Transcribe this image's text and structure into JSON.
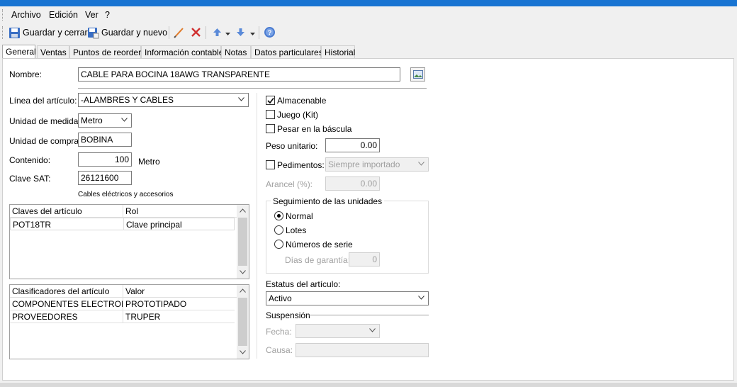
{
  "menu": {
    "archivo": "Archivo",
    "edicion": "Edición",
    "ver": "Ver",
    "help": "?"
  },
  "toolbar": {
    "save_close": "Guardar y cerrar",
    "save_new": "Guardar y nuevo"
  },
  "tabs": [
    "General",
    "Ventas",
    "Puntos de reorden",
    "Información contable",
    "Notas",
    "Datos particulares",
    "Historial"
  ],
  "form": {
    "nombre_label": "Nombre:",
    "nombre_value": "CABLE PARA BOCINA 18AWG TRANSPARENTE",
    "linea_label": "Línea del artículo:",
    "linea_value": "-ALAMBRES Y CABLES",
    "unidad_medida_label": "Unidad de medida:",
    "unidad_medida_value": "Metro",
    "unidad_compra_label": "Unidad de compra:",
    "unidad_compra_value": "BOBINA",
    "contenido_label": "Contenido:",
    "contenido_value": "100",
    "contenido_unit": "Metro",
    "clave_sat_label": "Clave SAT:",
    "clave_sat_value": "26121600",
    "clave_sat_desc": "Cables eléctricos y accesorios"
  },
  "claves_grid": {
    "headers": [
      "Claves del artículo",
      "Rol"
    ],
    "rows": [
      [
        "POT18TR",
        "Clave principal"
      ]
    ]
  },
  "clasif_grid": {
    "headers": [
      "Clasificadores del artículo",
      "Valor"
    ],
    "rows": [
      [
        "COMPONENTES ELECTRONICOS",
        "PROTOTIPADO"
      ],
      [
        "PROVEEDORES",
        "TRUPER"
      ]
    ]
  },
  "right": {
    "almacenable": "Almacenable",
    "almacenable_checked": true,
    "juego": "Juego (Kit)",
    "pesar": "Pesar en la báscula",
    "peso_label": "Peso unitario:",
    "peso_value": "0.00",
    "pedimentos_label": "Pedimentos:",
    "pedimentos_value": "Siempre importado",
    "arancel_label": "Arancel (%):",
    "arancel_value": "0.00",
    "seguimiento_title": "Seguimiento de las unidades",
    "normal": "Normal",
    "lotes": "Lotes",
    "series": "Números de serie",
    "dias_label": "Días de garantía:",
    "dias_value": "0",
    "estatus_label": "Estatus del artículo:",
    "estatus_value": "Activo",
    "suspension_title": "Suspensión",
    "fecha_label": "Fecha:",
    "causa_label": "Causa:"
  }
}
